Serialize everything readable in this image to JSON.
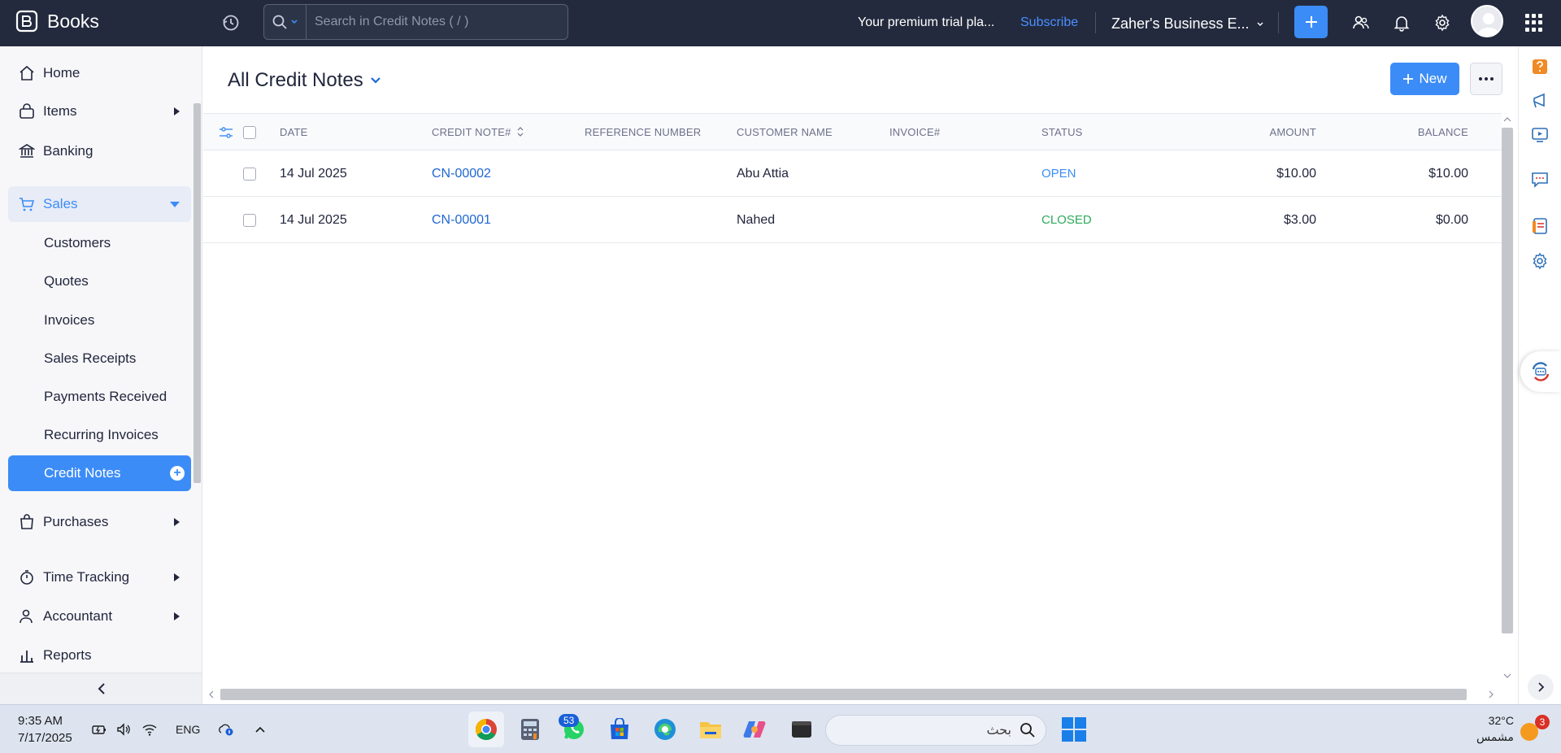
{
  "app": {
    "name": "Books"
  },
  "search": {
    "placeholder": "Search in Credit Notes ( / )"
  },
  "header": {
    "trial_text": "Your premium trial pla...",
    "subscribe_label": "Subscribe",
    "org_name": "Zaher's Business E..."
  },
  "sidebar": {
    "items": [
      {
        "label": "Home"
      },
      {
        "label": "Items"
      },
      {
        "label": "Banking"
      },
      {
        "label": "Sales"
      },
      {
        "label": "Purchases"
      },
      {
        "label": "Time Tracking"
      },
      {
        "label": "Accountant"
      },
      {
        "label": "Reports"
      }
    ],
    "sales_sub": [
      {
        "label": "Customers"
      },
      {
        "label": "Quotes"
      },
      {
        "label": "Invoices"
      },
      {
        "label": "Sales Receipts"
      },
      {
        "label": "Payments Received"
      },
      {
        "label": "Recurring Invoices"
      },
      {
        "label": "Credit Notes"
      }
    ]
  },
  "main": {
    "title": "All Credit Notes",
    "new_label": "New",
    "columns": [
      "DATE",
      "CREDIT NOTE#",
      "REFERENCE NUMBER",
      "CUSTOMER NAME",
      "INVOICE#",
      "STATUS",
      "AMOUNT",
      "BALANCE"
    ],
    "rows": [
      {
        "date": "14 Jul 2025",
        "credit_note": "CN-00002",
        "reference": "",
        "customer": "Abu Attia",
        "invoice": "",
        "status": "OPEN",
        "amount": "$10.00",
        "balance": "$10.00"
      },
      {
        "date": "14 Jul 2025",
        "credit_note": "CN-00001",
        "reference": "",
        "customer": "Nahed",
        "invoice": "",
        "status": "CLOSED",
        "amount": "$3.00",
        "balance": "$0.00"
      }
    ]
  },
  "taskbar": {
    "time": "9:35 AM",
    "date": "7/17/2025",
    "lang": "ENG",
    "whatsapp_badge": "53",
    "search_text": "بحث",
    "temperature": "32°C",
    "weather": "مشمس",
    "notifications": "3"
  },
  "colors": {
    "accent": "#3c8cf7",
    "topbar": "#232a3e",
    "open": "#3c8cf7",
    "closed": "#2daa5a",
    "link": "#1f67d2"
  }
}
